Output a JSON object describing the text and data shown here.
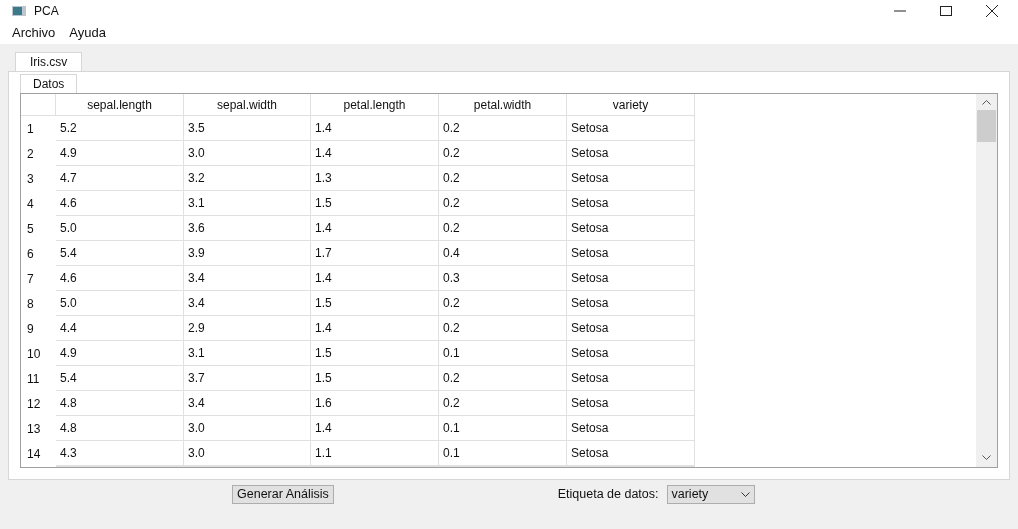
{
  "window": {
    "title": "PCA"
  },
  "menu": [
    "Archivo",
    "Ayuda"
  ],
  "file_tabs": [
    {
      "label": "Iris.csv",
      "selected": true
    }
  ],
  "sheet_tabs": [
    {
      "label": "Datos",
      "selected": true
    }
  ],
  "table": {
    "columns": [
      "sepal.length",
      "sepal.width",
      "petal.length",
      "petal.width",
      "variety"
    ],
    "rows": [
      {
        "index": "1",
        "cells": [
          "5.2",
          "3.5",
          "1.4",
          "0.2",
          "Setosa"
        ]
      },
      {
        "index": "2",
        "cells": [
          "4.9",
          "3.0",
          "1.4",
          "0.2",
          "Setosa"
        ]
      },
      {
        "index": "3",
        "cells": [
          "4.7",
          "3.2",
          "1.3",
          "0.2",
          "Setosa"
        ]
      },
      {
        "index": "4",
        "cells": [
          "4.6",
          "3.1",
          "1.5",
          "0.2",
          "Setosa"
        ]
      },
      {
        "index": "5",
        "cells": [
          "5.0",
          "3.6",
          "1.4",
          "0.2",
          "Setosa"
        ]
      },
      {
        "index": "6",
        "cells": [
          "5.4",
          "3.9",
          "1.7",
          "0.4",
          "Setosa"
        ]
      },
      {
        "index": "7",
        "cells": [
          "4.6",
          "3.4",
          "1.4",
          "0.3",
          "Setosa"
        ]
      },
      {
        "index": "8",
        "cells": [
          "5.0",
          "3.4",
          "1.5",
          "0.2",
          "Setosa"
        ]
      },
      {
        "index": "9",
        "cells": [
          "4.4",
          "2.9",
          "1.4",
          "0.2",
          "Setosa"
        ]
      },
      {
        "index": "10",
        "cells": [
          "4.9",
          "3.1",
          "1.5",
          "0.1",
          "Setosa"
        ]
      },
      {
        "index": "11",
        "cells": [
          "5.4",
          "3.7",
          "1.5",
          "0.2",
          "Setosa"
        ]
      },
      {
        "index": "12",
        "cells": [
          "4.8",
          "3.4",
          "1.6",
          "0.2",
          "Setosa"
        ]
      },
      {
        "index": "13",
        "cells": [
          "4.8",
          "3.0",
          "1.4",
          "0.1",
          "Setosa"
        ]
      },
      {
        "index": "14",
        "cells": [
          "4.3",
          "3.0",
          "1.1",
          "0.1",
          "Setosa"
        ]
      }
    ]
  },
  "generate_button": "Generar Análisis",
  "label_select": {
    "label": "Etiqueta de datos:",
    "value": "variety"
  }
}
